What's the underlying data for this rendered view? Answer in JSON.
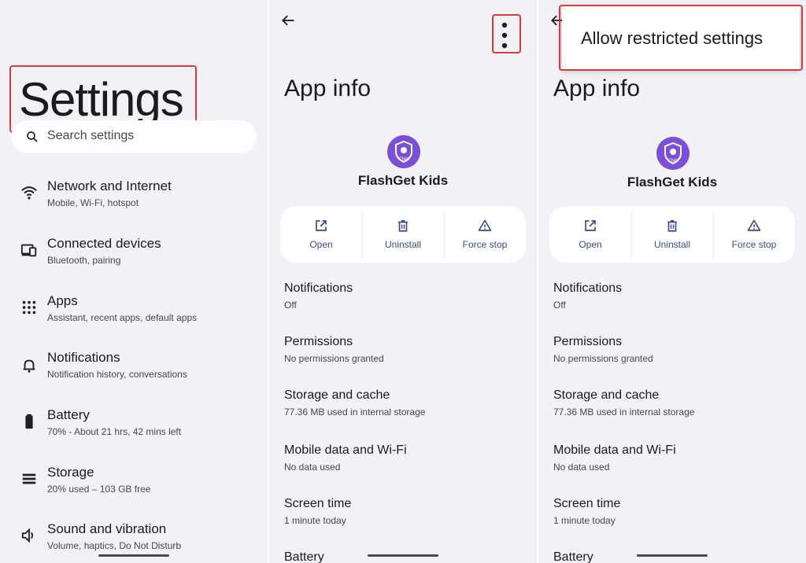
{
  "settings": {
    "title": "Settings",
    "search_placeholder": "Search settings",
    "items": [
      {
        "icon": "wifi-icon",
        "title": "Network and Internet",
        "subtitle": "Mobile, Wi-Fi, hotspot"
      },
      {
        "icon": "connected-devices-icon",
        "title": "Connected devices",
        "subtitle": "Bluetooth, pairing"
      },
      {
        "icon": "apps-grid-icon",
        "title": "Apps",
        "subtitle": "Assistant, recent apps, default apps"
      },
      {
        "icon": "bell-icon",
        "title": "Notifications",
        "subtitle": "Notification history, conversations"
      },
      {
        "icon": "battery-icon",
        "title": "Battery",
        "subtitle": "70% - About 21 hrs, 42 mins left"
      },
      {
        "icon": "storage-icon",
        "title": "Storage",
        "subtitle": "20% used – 103 GB free"
      },
      {
        "icon": "speaker-icon",
        "title": "Sound and vibration",
        "subtitle": "Volume, haptics, Do Not Disturb"
      }
    ]
  },
  "app_info": {
    "title": "App info",
    "app_name": "FlashGet Kids",
    "app_icon_label": "Child",
    "actions": [
      {
        "icon": "open-external-icon",
        "label": "Open"
      },
      {
        "icon": "trash-icon",
        "label": "Uninstall"
      },
      {
        "icon": "warning-icon",
        "label": "Force stop"
      }
    ],
    "rows": [
      {
        "title": "Notifications",
        "subtitle": "Off"
      },
      {
        "title": "Permissions",
        "subtitle": "No permissions granted"
      },
      {
        "title": "Storage and cache",
        "subtitle": "77.36 MB used in internal storage"
      },
      {
        "title": "Mobile data and Wi-Fi",
        "subtitle": "No data used"
      },
      {
        "title": "Screen time",
        "subtitle": "1 minute today"
      },
      {
        "title": "Battery",
        "subtitle": ""
      }
    ]
  },
  "overflow_menu": {
    "item": "Allow restricted settings"
  },
  "colors": {
    "panel_bg": "#f2f1f6",
    "highlight_red": "#d93a3a",
    "accent_blue": "#3b4a8a",
    "app_icon_purple": "#7b4fd8"
  }
}
